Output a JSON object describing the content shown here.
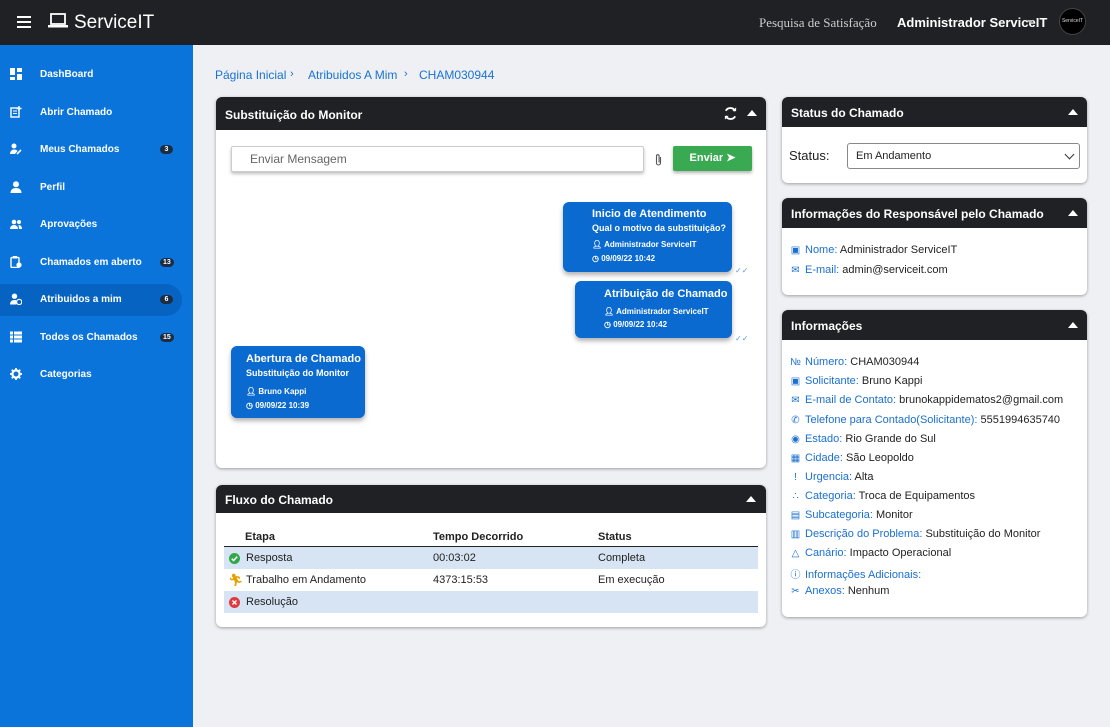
{
  "header": {
    "brand": "ServiceIT",
    "survey_link": "Pesquisa de Satisfação",
    "user_name": "Administrador ServiceIT",
    "avatar_text": "ServiceIT"
  },
  "sidebar": {
    "items": [
      {
        "label": "DashBoard",
        "icon": "dashboard-icon"
      },
      {
        "label": "Abrir Chamado",
        "icon": "new-ticket-icon"
      },
      {
        "label": "Meus Chamados",
        "icon": "user-edit-icon",
        "badge": "3"
      },
      {
        "label": "Perfil",
        "icon": "user-icon"
      },
      {
        "label": "Aprovações",
        "icon": "users-icon"
      },
      {
        "label": "Chamados em aberto",
        "icon": "clipboard-icon",
        "badge": "13"
      },
      {
        "label": "Atribuidos a mim",
        "icon": "user-clock-icon",
        "badge": "6",
        "active": true
      },
      {
        "label": "Todos os Chamados",
        "icon": "list-icon",
        "badge": "15"
      },
      {
        "label": "Categorias",
        "icon": "gear-icon"
      }
    ]
  },
  "breadcrumb": [
    "Página Inicial",
    "Atribuidos A Mim",
    "CHAM030944"
  ],
  "chat": {
    "title": "Substituição do Monitor",
    "placeholder": "Enviar Mensagem",
    "send_label": "Enviar",
    "messages": [
      {
        "title": "Inicio de Atendimento",
        "subtitle": "Qual o motivo da substituição?",
        "author": "Administrador ServiceIT",
        "time": "09/09/22 10:42"
      },
      {
        "title": "Atribuição de Chamado",
        "author": "Administrador ServiceIT",
        "time": "09/09/22 10:42"
      },
      {
        "title": "Abertura de Chamado",
        "subtitle": "Substituição do Monitor",
        "author": "Bruno Kappi",
        "time": "09/09/22 10:39"
      }
    ]
  },
  "flow": {
    "title": "Fluxo do Chamado",
    "columns": [
      "Etapa",
      "Tempo Decorrido",
      "Status"
    ],
    "rows": [
      {
        "stage": "Resposta",
        "elapsed": "00:03:02",
        "status": "Completa",
        "icon": "check-circle-icon"
      },
      {
        "stage": "Trabalho em Andamento",
        "elapsed": "4373:15:53",
        "status": "Em execução",
        "icon": "running-icon"
      },
      {
        "stage": "Resolução",
        "elapsed": "",
        "status": "",
        "icon": "x-circle-icon"
      }
    ]
  },
  "status_card": {
    "title": "Status do Chamado",
    "label": "Status:",
    "value": "Em Andamento"
  },
  "responsible": {
    "title": "Informações do Responsável pelo Chamado",
    "name_label": "Nome:",
    "name": "Administrador ServiceIT",
    "email_label": "E-mail:",
    "email": "admin@serviceit.com"
  },
  "info": {
    "title": "Informações",
    "rows": [
      {
        "label": "Número:",
        "value": "CHAM030944",
        "icon": "hash-icon"
      },
      {
        "label": "Solicitante:",
        "value": "Bruno Kappi",
        "icon": "id-card-icon"
      },
      {
        "label": "E-mail de Contato:",
        "value": "brunokappidematos2@gmail.com",
        "icon": "envelope-icon"
      },
      {
        "label": "Telefone para Contado(Solicitante):",
        "value": "5551994635740",
        "icon": "phone-icon"
      },
      {
        "label": "Estado:",
        "value": "Rio Grande do Sul",
        "icon": "map-pin-icon"
      },
      {
        "label": "Cidade:",
        "value": "São Leopoldo",
        "icon": "city-icon"
      },
      {
        "label": "Urgencia:",
        "value": "Alta",
        "icon": "exclamation-icon"
      },
      {
        "label": "Categoria:",
        "value": "Troca de Equipamentos",
        "icon": "sitemap-icon"
      },
      {
        "label": "Subcategoria:",
        "value": "Monitor",
        "icon": "monitor-icon"
      },
      {
        "label": "Descrição do Problema:",
        "value": "Substituição do Monitor",
        "icon": "document-icon"
      },
      {
        "label": "Canário:",
        "value": "Impacto Operacional",
        "icon": "warning-icon"
      },
      {
        "label": "Informações Adicionais:",
        "value": "",
        "icon": "info-icon"
      },
      {
        "label": "Anexos:",
        "value": "Nenhum",
        "icon": "paperclip-icon"
      }
    ]
  }
}
